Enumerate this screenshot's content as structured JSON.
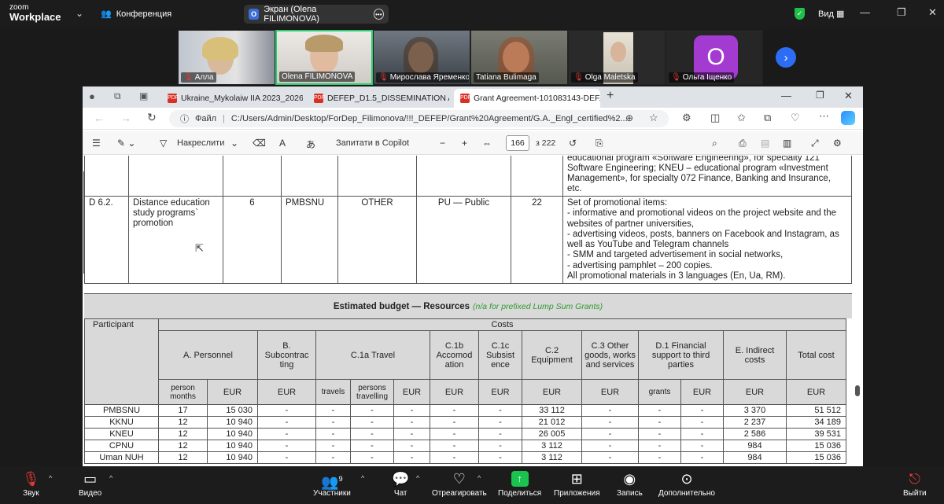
{
  "zoom": {
    "logo_top": "zoom",
    "logo_bottom": "Workplace",
    "meeting_title": "Конференция",
    "screen_share_label": "Экран (Olena FILIMONOVA)",
    "view_label": "Вид",
    "accent_green": "#2ecc71",
    "share_green": "#19c34e"
  },
  "participants": [
    {
      "name": "Алла",
      "muted": true
    },
    {
      "name": "Olena FILIMONOVA",
      "muted": false
    },
    {
      "name": "Мирослава Яременко...",
      "muted": true
    },
    {
      "name": "Tatiana Bulimaga",
      "muted": false
    },
    {
      "name": "Olga Maletska",
      "muted": true
    },
    {
      "name": "Ольга Іщенко",
      "muted": true,
      "avatar_letter": "O"
    }
  ],
  "browser": {
    "tabs": [
      {
        "label": "Ukraine_Mykolaiw IIA 2023_2026..."
      },
      {
        "label": "DEFEP_D1.5_DISSEMINATION AN..."
      },
      {
        "label": "Grant Agreement-101083143-DEF..."
      }
    ],
    "file_label": "Файл",
    "url": "C:/Users/Admin/Desktop/ForDep_Filimonova/!!!_DEFEP/Grant%20Agreement/G.A._Engl_certified%2...",
    "pdf_toolbar": {
      "draw_label": "Накреслити",
      "copilot_label": "Запитати в Copilot",
      "page_current": "166",
      "page_total": "з 222"
    }
  },
  "document": {
    "top_row_desc": [
      "educational program «Software Engineering», for specialty 121",
      "Software Engineering; KNEU  – educational program «Investment",
      "Management», for specialty 072 Finance, Banking and Insurance, etc."
    ],
    "deliverable": {
      "code": "D 6.2.",
      "title": "Distance education study programs` promotion",
      "number": "6",
      "lead": "PMBSNU",
      "type": "OTHER",
      "dissemination": "PU — Public",
      "month": "22",
      "description": [
        "Set of promotional items:",
        "-   informative and promotional videos on the project website and the",
        "websites of partner universities,",
        "-   advertising videos, posts, banners on Facebook and Instagram, as",
        "well as YouTube and Telegram channels",
        "-   SMM and targeted advertisement in social networks,",
        "-   advertising pamphlet – 200 copies.",
        "All promotional materials in 3 languages (En, Ua, RM)."
      ]
    },
    "budget": {
      "title": "Estimated budget — Resources",
      "subtitle": "(n/a for prefixed Lump Sum Grants)",
      "participant_header": "Participant",
      "costs_header": "Costs",
      "groups": {
        "personnel": "A. Personnel",
        "subcontracting": "B. Subcontrac ting",
        "travel": "C.1a Travel",
        "accommodation": "C.1b Accomod ation",
        "subsistence": "C.1c Subsist ence",
        "equipment": "C.2 Equipment",
        "other": "C.3 Other goods, works and services",
        "financial": "D.1 Financial support to third parties",
        "indirect": "E. Indirect costs",
        "total": "Total cost"
      },
      "sub": {
        "person_months": "person months",
        "eur": "EUR",
        "travels": "travels",
        "persons_travelling": "persons travelling",
        "grants": "grants"
      },
      "rows": [
        {
          "p": "PMBSNU",
          "pm": "17",
          "eur": "15 030",
          "eq": "33 112",
          "ind": "3 370",
          "tot": "51 512"
        },
        {
          "p": "KKNU",
          "pm": "12",
          "eur": "10 940",
          "eq": "21 012",
          "ind": "2 237",
          "tot": "34 189"
        },
        {
          "p": "KNEU",
          "pm": "12",
          "eur": "10 940",
          "eq": "26 005",
          "ind": "2 586",
          "tot": "39 531"
        },
        {
          "p": "CPNU",
          "pm": "12",
          "eur": "10 940",
          "eq": "3 112",
          "ind": "984",
          "tot": "15 036"
        },
        {
          "p": "Uman NUH",
          "pm": "12",
          "eur": "10 940",
          "eq": "3 112",
          "ind": "984",
          "tot": "15 036"
        }
      ],
      "dash": "-"
    }
  },
  "bottom_bar": {
    "sound": "Звук",
    "video": "Видео",
    "participants": "Участники",
    "participants_count": "9",
    "chat": "Чат",
    "react": "Отреагировать",
    "share": "Поделиться",
    "apps": "Приложения",
    "record": "Запись",
    "more": "Дополнительно",
    "leave": "Выйти"
  }
}
